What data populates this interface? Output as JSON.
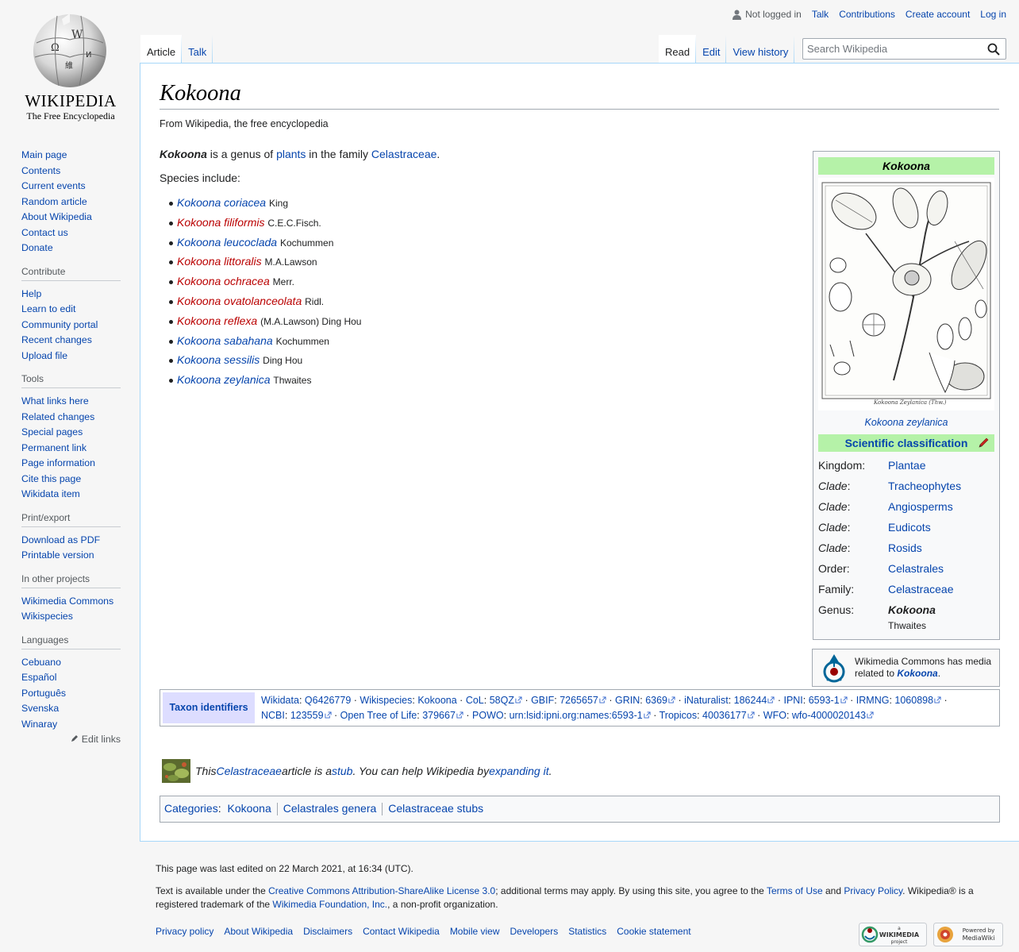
{
  "logo": {
    "wordmark": "WIKIPEDIA",
    "tagline": "The Free Encyclopedia"
  },
  "sidebar": {
    "main": [
      "Main page",
      "Contents",
      "Current events",
      "Random article",
      "About Wikipedia",
      "Contact us",
      "Donate"
    ],
    "contribute": {
      "heading": "Contribute",
      "items": [
        "Help",
        "Learn to edit",
        "Community portal",
        "Recent changes",
        "Upload file"
      ]
    },
    "tools": {
      "heading": "Tools",
      "items": [
        "What links here",
        "Related changes",
        "Special pages",
        "Permanent link",
        "Page information",
        "Cite this page",
        "Wikidata item"
      ]
    },
    "print": {
      "heading": "Print/export",
      "items": [
        "Download as PDF",
        "Printable version"
      ]
    },
    "projects": {
      "heading": "In other projects",
      "items": [
        "Wikimedia Commons",
        "Wikispecies"
      ]
    },
    "languages": {
      "heading": "Languages",
      "items": [
        "Cebuano",
        "Español",
        "Português",
        "Svenska",
        "Winaray"
      ],
      "edit_links": "Edit links"
    }
  },
  "user_tools": {
    "not_logged_in": "Not logged in",
    "talk": "Talk",
    "contributions": "Contributions",
    "create_account": "Create account",
    "log_in": "Log in"
  },
  "tabs": {
    "article": "Article",
    "talk": "Talk",
    "read": "Read",
    "edit": "Edit",
    "view_history": "View history"
  },
  "search": {
    "placeholder": "Search Wikipedia"
  },
  "article": {
    "title": "Kokoona",
    "tagline": "From Wikipedia, the free encyclopedia",
    "intro": {
      "subject": "Kokoona",
      "t1": " is a genus of ",
      "plants": "plants",
      "t2": " in the family ",
      "family": "Celastraceae",
      "t3": "."
    },
    "species_intro": "Species include:",
    "species": [
      {
        "name": "Kokoona coriacea",
        "author": "King",
        "exists": true
      },
      {
        "name": "Kokoona filiformis",
        "author": "C.E.C.Fisch.",
        "exists": false
      },
      {
        "name": "Kokoona leucoclada",
        "author": "Kochummen",
        "exists": true
      },
      {
        "name": "Kokoona littoralis",
        "author": "M.A.Lawson",
        "exists": false
      },
      {
        "name": "Kokoona ochracea",
        "author": "Merr.",
        "exists": false
      },
      {
        "name": "Kokoona ovatolanceolata",
        "author": "Ridl.",
        "exists": false
      },
      {
        "name": "Kokoona reflexa",
        "author": "(M.A.Lawson) Ding Hou",
        "exists": false
      },
      {
        "name": "Kokoona sabahana",
        "author": "Kochummen",
        "exists": true
      },
      {
        "name": "Kokoona sessilis",
        "author": "Ding Hou",
        "exists": true
      },
      {
        "name": "Kokoona zeylanica",
        "author": "Thwaites",
        "exists": true
      }
    ]
  },
  "infobox": {
    "title": "Kokoona",
    "caption": "Kokoona zeylanica",
    "classification_heading": "Scientific classification",
    "rows": [
      {
        "rank": "Kingdom:",
        "italic": false,
        "value": "Plantae"
      },
      {
        "rank": "Clade",
        "italic": true,
        "value": "Tracheophytes"
      },
      {
        "rank": "Clade",
        "italic": true,
        "value": "Angiosperms"
      },
      {
        "rank": "Clade",
        "italic": true,
        "value": "Eudicots"
      },
      {
        "rank": "Clade",
        "italic": true,
        "value": "Rosids"
      },
      {
        "rank": "Order:",
        "italic": false,
        "value": "Celastrales"
      },
      {
        "rank": "Family:",
        "italic": false,
        "value": "Celastraceae"
      },
      {
        "rank": "Genus:",
        "italic": false,
        "value": "Kokoona"
      }
    ],
    "genus_author": "Thwaites"
  },
  "commons": {
    "text": "Wikimedia Commons has media related to ",
    "link": "Kokoona",
    "end": "."
  },
  "taxon": {
    "heading": "Taxon identifiers",
    "items": [
      {
        "db": "Wikidata",
        "id": "Q6426779",
        "ext": false
      },
      {
        "db": "Wikispecies",
        "id": "Kokoona",
        "ext": false
      },
      {
        "db": "CoL",
        "id": "58QZ",
        "ext": true
      },
      {
        "db": "GBIF",
        "id": "7265657",
        "ext": true
      },
      {
        "db": "GRIN",
        "id": "6369",
        "ext": true
      },
      {
        "db": "iNaturalist",
        "id": "186244",
        "ext": true
      },
      {
        "db": "IPNI",
        "id": "6593-1",
        "ext": true
      },
      {
        "db": "IRMNG",
        "id": "1060898",
        "ext": true
      },
      {
        "db": "NCBI",
        "id": "123559",
        "ext": true
      },
      {
        "db": "Open Tree of Life",
        "id": "379667",
        "ext": true
      },
      {
        "db": "POWO",
        "id": "urn:lsid:ipni.org:names:6593-1",
        "ext": true
      },
      {
        "db": "Tropicos",
        "id": "40036177",
        "ext": true
      },
      {
        "db": "WFO",
        "id": "wfo-4000020143",
        "ext": true
      }
    ]
  },
  "stub": {
    "t1": "This ",
    "family": "Celastraceae",
    "t2": " article is a ",
    "stub": "stub",
    "t3": ". You can help Wikipedia by ",
    "expand": "expanding it",
    "t4": "."
  },
  "categories": {
    "label": "Categories",
    "items": [
      "Kokoona",
      "Celastrales genera",
      "Celastraceae stubs"
    ]
  },
  "footer": {
    "last_edited": "This page was last edited on 22 March 2021, at 16:34 (UTC).",
    "license_t1": "Text is available under the ",
    "license_link": "Creative Commons Attribution-ShareAlike License 3.0",
    "license_t2": "; additional terms may apply. By using this site, you agree to the ",
    "terms": "Terms of Use",
    "and": " and ",
    "privacy": "Privacy Policy",
    "license_t3": ". Wikipedia® is a registered trademark of the ",
    "foundation": "Wikimedia Foundation, Inc.",
    "license_t4": ", a non-profit organization.",
    "links": [
      "Privacy policy",
      "About Wikipedia",
      "Disclaimers",
      "Contact Wikipedia",
      "Mobile view",
      "Developers",
      "Statistics",
      "Cookie statement"
    ],
    "badge_wm": {
      "small": "a",
      "name": "WIKIMEDIA",
      "sub": "project"
    },
    "badge_mw": {
      "small": "Powered by",
      "name": "MediaWiki"
    }
  }
}
